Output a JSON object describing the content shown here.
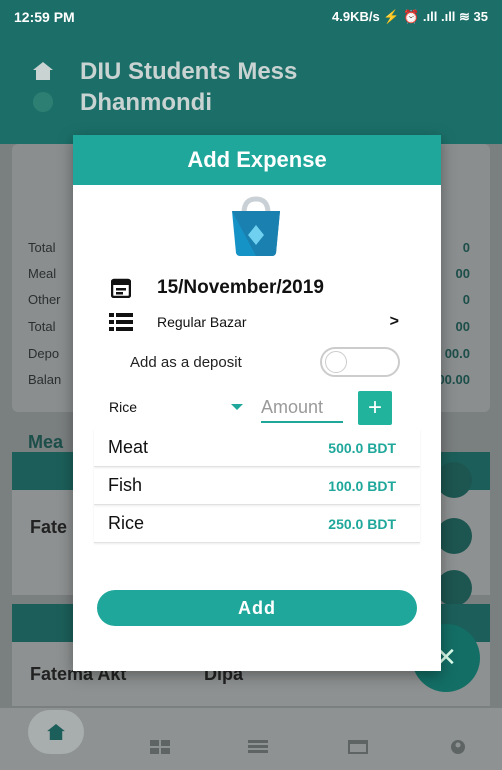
{
  "status_bar": {
    "time": "12:59 PM",
    "indicators": "4.9KB/s ⚡ ⏰ .ıll .ıll ≋ 35"
  },
  "header": {
    "title_line1": "DIU Students Mess",
    "title_line2": "Dhanmondi"
  },
  "background": {
    "summary_labels": [
      "Total",
      "Meal",
      "Other",
      "Total",
      "Depo",
      "Balan"
    ],
    "summary_values": [
      "0",
      "00",
      "0",
      "00",
      "00.0",
      "00.00"
    ],
    "meal_heading": "Mea",
    "member_1": "Fate",
    "member_2_first": "Fatema Akt",
    "member_2_last": "Dipa",
    "fab_icon": "close-icon"
  },
  "dialog": {
    "title": "Add Expense",
    "icon": "shopping-bag-icon",
    "date": "15/November/2019",
    "category": "Regular Bazar",
    "deposit_label": "Add as a deposit",
    "deposit_on": false,
    "selected_item": "Rice",
    "amount_placeholder": "Amount",
    "plus_label": "+",
    "expenses": [
      {
        "name": "Meat",
        "amount": "500.0 BDT"
      },
      {
        "name": "Fish",
        "amount": "100.0 BDT"
      },
      {
        "name": "Rice",
        "amount": "250.0 BDT"
      }
    ],
    "add_label": "Add"
  },
  "colors": {
    "accent": "#1ea79a",
    "header_bg": "#1c6f69"
  }
}
